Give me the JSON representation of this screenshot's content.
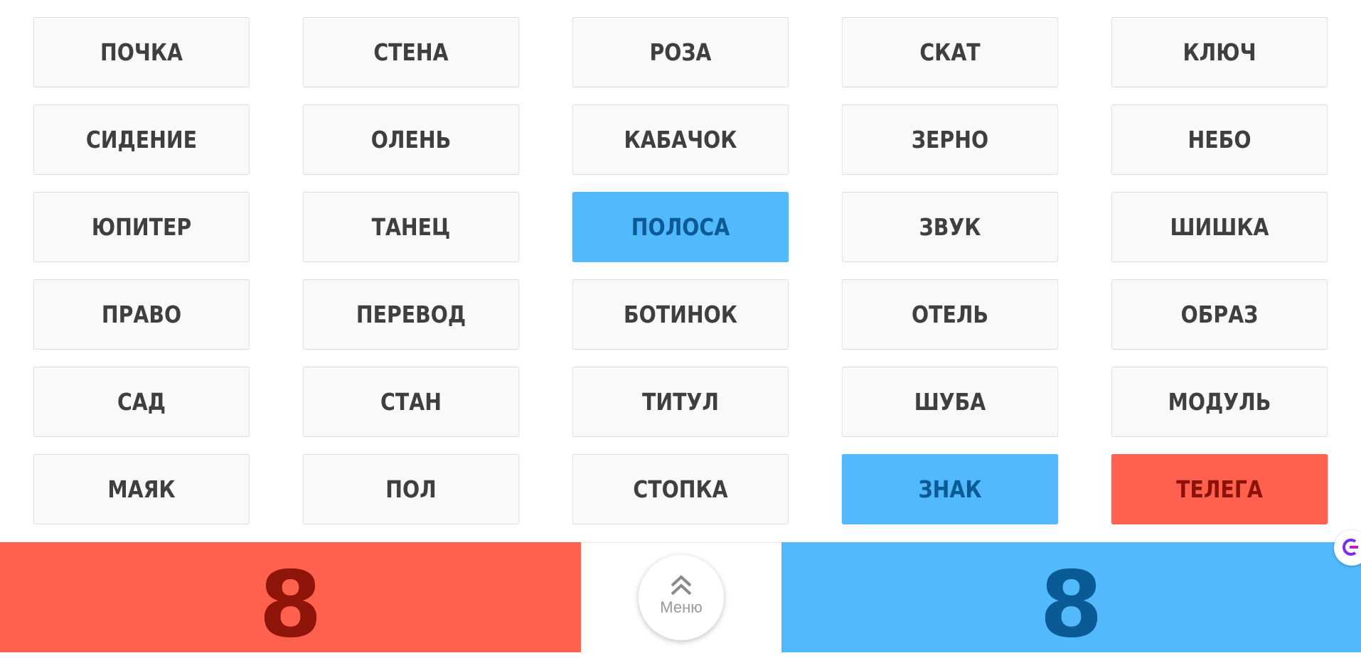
{
  "board": {
    "cards": [
      {
        "word": "ПОЧКА",
        "team": "neutral"
      },
      {
        "word": "СТЕНА",
        "team": "neutral"
      },
      {
        "word": "РОЗА",
        "team": "neutral"
      },
      {
        "word": "СКАТ",
        "team": "neutral"
      },
      {
        "word": "КЛЮЧ",
        "team": "neutral"
      },
      {
        "word": "СИДЕНИЕ",
        "team": "neutral"
      },
      {
        "word": "ОЛЕНЬ",
        "team": "neutral"
      },
      {
        "word": "КАБАЧОК",
        "team": "neutral"
      },
      {
        "word": "ЗЕРНО",
        "team": "neutral"
      },
      {
        "word": "НЕБО",
        "team": "neutral"
      },
      {
        "word": "ЮПИТЕР",
        "team": "neutral"
      },
      {
        "word": "ТАНЕЦ",
        "team": "neutral"
      },
      {
        "word": "ПОЛОСА",
        "team": "blue"
      },
      {
        "word": "ЗВУК",
        "team": "neutral"
      },
      {
        "word": "ШИШКА",
        "team": "neutral"
      },
      {
        "word": "ПРАВО",
        "team": "neutral"
      },
      {
        "word": "ПЕРЕВОД",
        "team": "neutral"
      },
      {
        "word": "БОТИНОК",
        "team": "neutral"
      },
      {
        "word": "ОТЕЛЬ",
        "team": "neutral"
      },
      {
        "word": "ОБРАЗ",
        "team": "neutral"
      },
      {
        "word": "САД",
        "team": "neutral"
      },
      {
        "word": "СТАН",
        "team": "neutral"
      },
      {
        "word": "ТИТУЛ",
        "team": "neutral"
      },
      {
        "word": "ШУБА",
        "team": "neutral"
      },
      {
        "word": "МОДУЛЬ",
        "team": "neutral"
      },
      {
        "word": "МАЯК",
        "team": "neutral"
      },
      {
        "word": "ПОЛ",
        "team": "neutral"
      },
      {
        "word": "СТОПКА",
        "team": "neutral"
      },
      {
        "word": "ЗНАК",
        "team": "blue"
      },
      {
        "word": "ТЕЛЕГА",
        "team": "red"
      }
    ]
  },
  "scores": {
    "red": "8",
    "blue": "8"
  },
  "menu": {
    "label": "Меню",
    "icon": "double-chevron-up-icon"
  },
  "colors": {
    "red": "#fe624f",
    "blue": "#52b9fc",
    "neutral_card": "#f9f9f9",
    "card_text": "#3f3f3f"
  }
}
